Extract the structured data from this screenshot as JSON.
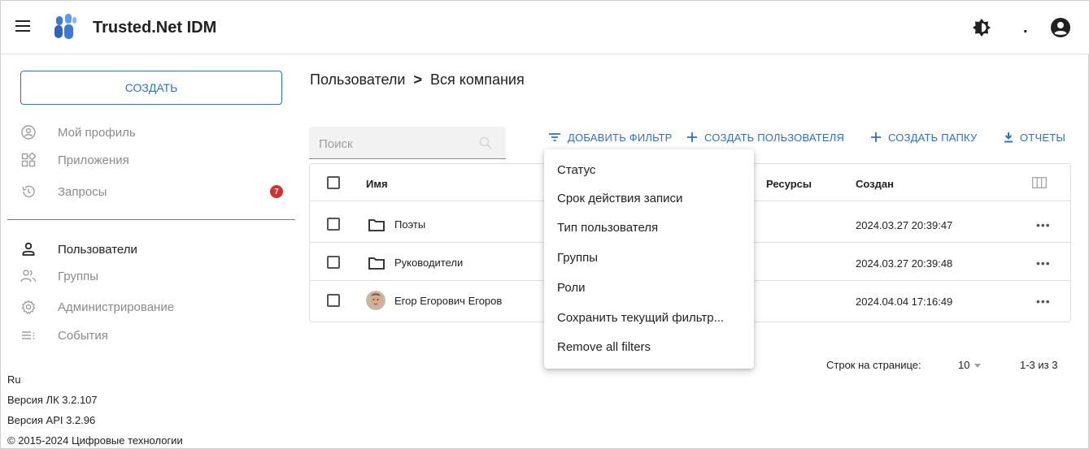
{
  "header": {
    "title": "Trusted.Net IDM",
    "extra_glyph": ".",
    "icons": [
      "menu-icon",
      "logo",
      "theme-toggle-icon",
      "account-icon"
    ]
  },
  "sidebar": {
    "create_label": "СОЗДАТЬ",
    "items_top": [
      {
        "label": "Мой профиль",
        "icon": "profile-icon"
      },
      {
        "label": "Приложения",
        "icon": "apps-icon"
      },
      {
        "label": "Запросы",
        "icon": "history-icon",
        "badge": "7"
      }
    ],
    "items_bottom": [
      {
        "label": "Пользователи",
        "icon": "user-icon",
        "active": true
      },
      {
        "label": "Группы",
        "icon": "group-icon"
      },
      {
        "label": "Администрирование",
        "icon": "settings-icon"
      },
      {
        "label": "События",
        "icon": "events-icon"
      }
    ],
    "footer": {
      "lang": "Ru",
      "version_lk": "Версия ЛК 3.2.107",
      "version_api": "Версия API 3.2.96",
      "copyright": "© 2015-2024 Цифровые технологии"
    },
    "badge_color": "#d32f2f"
  },
  "main": {
    "breadcrumb": {
      "root": "Пользователи",
      "separator": ">",
      "current": "Вся компания"
    },
    "search": {
      "placeholder": "Поиск",
      "value": ""
    },
    "toolbar": {
      "add_filter": "ДОБАВИТЬ ФИЛЬТР",
      "create_user": "СОЗДАТЬ ПОЛЬЗОВАТЕЛЯ",
      "create_folder": "СОЗДАТЬ ПАПКУ",
      "reports": "ОТЧЕТЫ"
    },
    "accent_color": "#2e6fc9",
    "table": {
      "columns": {
        "name": "Имя",
        "resources": "Ресурсы",
        "created": "Создан"
      },
      "rows": [
        {
          "name": "Поэты",
          "type": "folder",
          "created": "2024.03.27 20:39:47",
          "actions": "•••"
        },
        {
          "name": "Руководители",
          "type": "folder",
          "created": "2024.03.27 20:39:48",
          "actions": "•••"
        },
        {
          "name": "Егор Егорович Егоров",
          "type": "user",
          "created": "2024.04.04 17:16:49",
          "actions": "•••"
        }
      ]
    },
    "pagination": {
      "rows_per_page_label": "Строк на странице:",
      "rows_per_page": "10",
      "range": "1-3 из 3"
    },
    "filter_menu": {
      "items": [
        "Статус",
        "Срок действия записи",
        "Тип пользователя",
        "Группы",
        "Роли",
        "Сохранить текущий фильтр...",
        "Remove all filters"
      ]
    }
  }
}
